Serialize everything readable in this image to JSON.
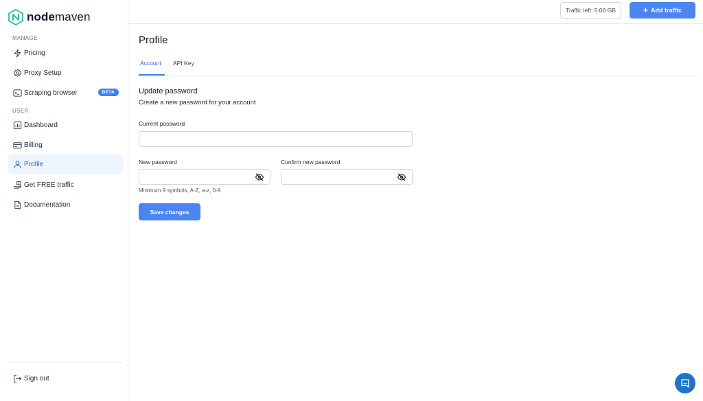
{
  "brand": {
    "name_bold": "node",
    "name_light": "maven"
  },
  "sidebar": {
    "sections": {
      "manage": "MANAGE",
      "user": "USER"
    },
    "items": [
      {
        "label": "Pricing",
        "icon": "lightning-icon"
      },
      {
        "label": "Proxy Setup",
        "icon": "gear-icon"
      },
      {
        "label": "Scraping browser",
        "icon": "terminal-icon",
        "badge": "BETA"
      },
      {
        "label": "Dashboard",
        "icon": "bar-chart-icon"
      },
      {
        "label": "Billing",
        "icon": "credit-card-icon"
      },
      {
        "label": "Profile",
        "icon": "user-icon",
        "active": true
      },
      {
        "label": "Get FREE traffic",
        "icon": "gift-hand-icon"
      },
      {
        "label": "Documentation",
        "icon": "document-icon"
      }
    ],
    "sign_out": {
      "label": "Sign out",
      "icon": "sign-out-icon"
    }
  },
  "header": {
    "traffic_left": "Traffic left: 5.00 GB",
    "add_traffic": "Add traffic"
  },
  "main": {
    "title": "Profile",
    "tabs": [
      {
        "label": "Account",
        "active": true
      },
      {
        "label": "API Key",
        "active": false
      }
    ],
    "section_title": "Update password",
    "section_subtitle": "Create a new password for your account",
    "fields": {
      "current_password": {
        "label": "Current password",
        "value": ""
      },
      "new_password": {
        "label": "New password",
        "value": ""
      },
      "confirm_password": {
        "label": "Confirm new password",
        "value": ""
      }
    },
    "hint": "Minimum 9 symbols, A-Z, a-z, 0-9",
    "save_label": "Save changes"
  },
  "colors": {
    "accent": "#4b86f0",
    "active_bg": "#eff5fe",
    "chat": "#1f73c8"
  }
}
